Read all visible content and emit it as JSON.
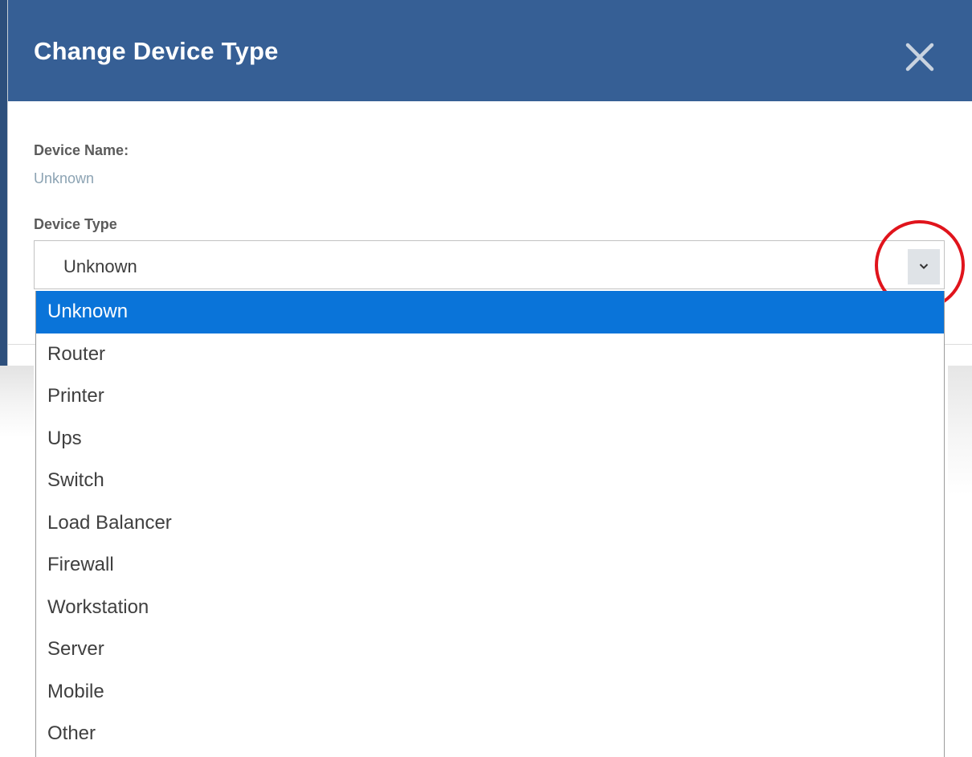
{
  "dialog": {
    "title": "Change Device Type",
    "close_icon": "close-icon"
  },
  "device_name": {
    "label": "Device Name:",
    "value": "Unknown"
  },
  "device_type": {
    "label": "Device Type",
    "selected": "Unknown",
    "arrow_icon": "chevron-down-icon",
    "options": [
      "Unknown",
      "Router",
      "Printer",
      "Ups",
      "Switch",
      "Load Balancer",
      "Firewall",
      "Workstation",
      "Server",
      "Mobile",
      "Other"
    ],
    "highlighted_option": "Unknown"
  },
  "colors": {
    "header_bg": "#365f95",
    "selected_option_bg": "#0a74d9",
    "annotation_ring": "#e0141c",
    "label_text": "#5b5b5b",
    "value_text": "#8ca3b3"
  }
}
